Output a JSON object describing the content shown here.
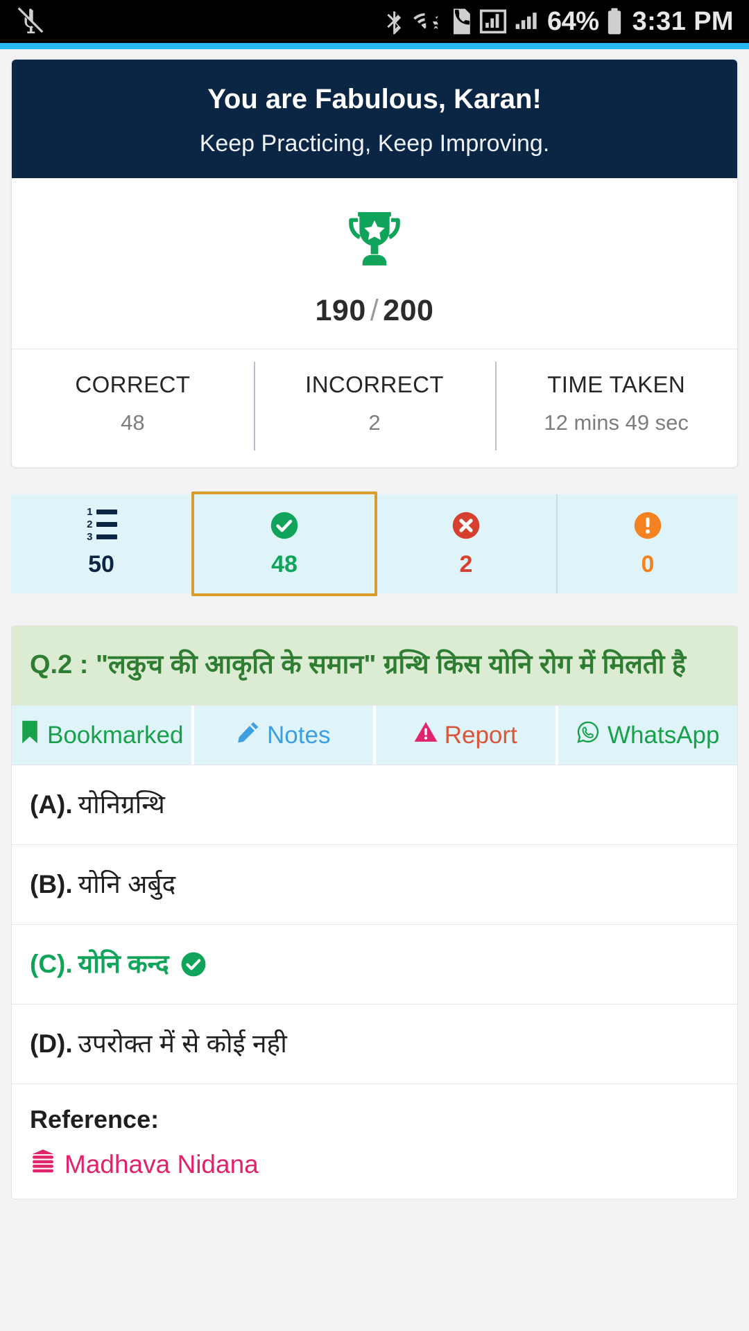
{
  "status_bar": {
    "battery_percent": "64%",
    "clock": "3:31 PM",
    "icons": [
      "mute-icon",
      "bluetooth-icon",
      "wifi-icon",
      "sim-call-icon",
      "signal-bars-icon",
      "signal-bars-2-icon",
      "battery-icon"
    ]
  },
  "accent_color": "#29b6f6",
  "summary": {
    "headline": "You are Fabulous, Karan!",
    "subline": "Keep Practicing, Keep Improving.",
    "trophy_icon": "trophy-star-icon",
    "score_obtained": "190",
    "score_separator": "/",
    "score_total": "200",
    "stats": [
      {
        "label": "CORRECT",
        "value": "48"
      },
      {
        "label": "INCORRECT",
        "value": "2"
      },
      {
        "label": "TIME TAKEN",
        "value": "12 mins 49 sec"
      }
    ]
  },
  "filter_tabs": [
    {
      "key": "all",
      "icon": "numbered-list-icon",
      "count": "50",
      "color": "#0b2545",
      "selected": false
    },
    {
      "key": "correct",
      "icon": "check-circle-icon",
      "count": "48",
      "color": "#10a35a",
      "selected": true
    },
    {
      "key": "incorrect",
      "icon": "cross-circle-icon",
      "count": "2",
      "color": "#d6402e",
      "selected": false
    },
    {
      "key": "unattempted",
      "icon": "exclamation-circle-icon",
      "count": "0",
      "color": "#f58220",
      "selected": false
    }
  ],
  "selected_tab_border_color": "#d99b2a",
  "question": {
    "text": "Q.2 : \"लकुच की आकृति के समान\" ग्रन्थि किस योनि रोग में मिलती है",
    "actions": [
      {
        "key": "bookmark",
        "icon": "bookmark-icon",
        "label": "Bookmarked",
        "color": "#18a04b"
      },
      {
        "key": "notes",
        "icon": "pencil-icon",
        "label": "Notes",
        "color": "#3d9ee0"
      },
      {
        "key": "report",
        "icon": "warning-triangle-icon",
        "label": "Report",
        "color": "#d9563b"
      },
      {
        "key": "whatsapp",
        "icon": "whatsapp-icon",
        "label": "WhatsApp",
        "color": "#18a04b"
      }
    ],
    "options": [
      {
        "key": "(A).",
        "text": "योनिग्रन्थि",
        "correct": false
      },
      {
        "key": "(B).",
        "text": "योनि अर्बुद",
        "correct": false
      },
      {
        "key": "(C).",
        "text": "योनि कन्द",
        "correct": true
      },
      {
        "key": "(D).",
        "text": "उपरोक्त में से कोई नही",
        "correct": false
      }
    ],
    "reference": {
      "title": "Reference:",
      "icon": "book-stack-icon",
      "name": "Madhava Nidana"
    }
  }
}
